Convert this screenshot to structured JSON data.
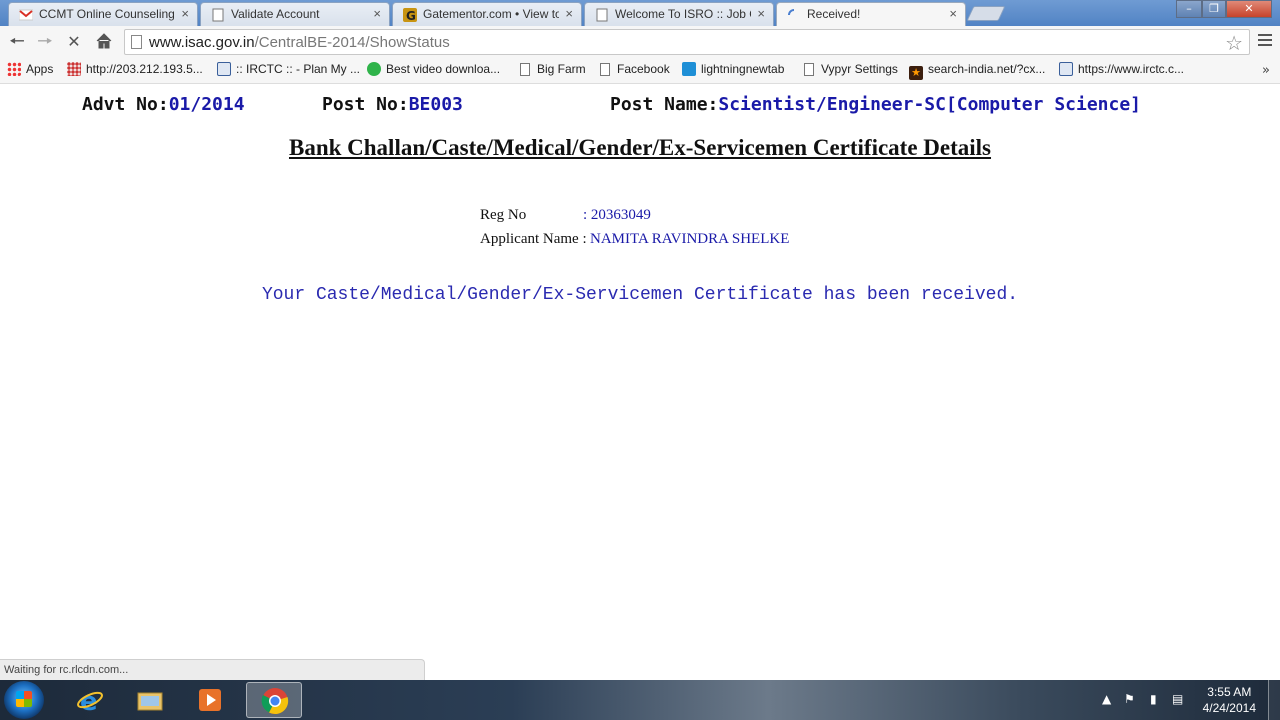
{
  "browser": {
    "tabs": [
      {
        "title": "CCMT Online Counseling",
        "icon": "gmail-icon"
      },
      {
        "title": "Validate Account",
        "icon": "page-icon"
      },
      {
        "title": "Gatementor.com • View to",
        "icon": "gatementor-icon"
      },
      {
        "title": "Welcome To ISRO :: Job O",
        "icon": "page-icon"
      },
      {
        "title": "Received!",
        "icon": "loading-icon"
      }
    ],
    "tab_close": "×",
    "url_host": "www.isac.gov.in",
    "url_path": "/CentralBE-2014/ShowStatus",
    "bookmarks": [
      {
        "label": "Apps"
      },
      {
        "label": "http://203.212.193.5..."
      },
      {
        "label": ":: IRCTC :: - Plan My ..."
      },
      {
        "label": "Best video downloa..."
      },
      {
        "label": "Big Farm"
      },
      {
        "label": "Facebook"
      },
      {
        "label": "lightningnewtab"
      },
      {
        "label": "Vypyr Settings"
      },
      {
        "label": "search-india.net/?cx..."
      },
      {
        "label": "https://www.irctc.c..."
      }
    ],
    "more_bookmarks": "»",
    "status_text": "Waiting for rc.rlcdn.com..."
  },
  "page": {
    "advt_label": "Advt No:",
    "advt_value": "01/2014",
    "post_no_label": "Post No:",
    "post_no_value": "BE003",
    "post_name_label": "Post Name:",
    "post_name_value": "Scientist/Engineer-SC[Computer Science]",
    "heading": "Bank Challan/Caste/Medical/Gender/Ex-Servicemen Certificate Details",
    "reg_no_label": "Reg No",
    "reg_no_value": ": 20363049",
    "applicant_label": "Applicant Name :",
    "applicant_value": "NAMITA RAVINDRA SHELKE",
    "message": "Your Caste/Medical/Gender/Ex-Servicemen Certificate has been received."
  },
  "taskbar": {
    "time": "3:55 AM",
    "date": "4/24/2014"
  },
  "colors": {
    "value_blue": "#1a1aa8",
    "message_blue": "#2a2ab0"
  }
}
